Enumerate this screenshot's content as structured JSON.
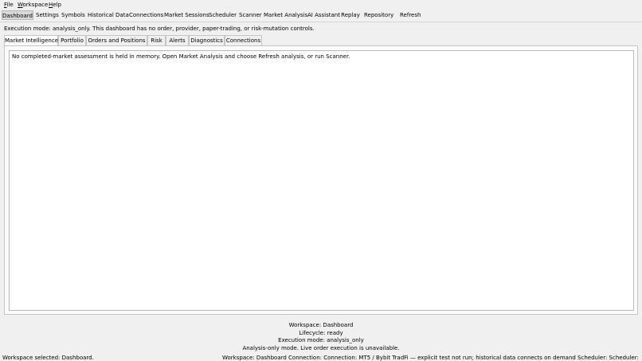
{
  "menubar": {
    "items": [
      {
        "mnemonic": "F",
        "rest": "ile"
      },
      {
        "mnemonic": "W",
        "rest": "orkspace"
      },
      {
        "mnemonic": "H",
        "rest": "elp"
      }
    ]
  },
  "toolbar": {
    "items": [
      "Dashboard",
      "Settings",
      "Symbols",
      "Historical Data",
      "Connections",
      "Market Sessions",
      "Scheduler",
      "Scanner",
      "Market Analysis",
      "AI Assistant",
      "Replay",
      "Repository",
      "Refresh"
    ],
    "active": "Dashboard"
  },
  "execution_note": "Execution mode: analysis_only. This dashboard has no order, provider, paper-trading, or risk-mutation controls.",
  "tabs": {
    "items": [
      "Market Intelligence",
      "Portfolio",
      "Orders and Positions",
      "Risk",
      "Alerts",
      "Diagnostics",
      "Connections"
    ],
    "active": "Market Intelligence"
  },
  "panel": {
    "message": "No completed-market assessment is held in memory. Open Market Analysis and choose Refresh analysis, or run Scanner."
  },
  "info": {
    "workspace": "Workspace: Dashboard",
    "lifecycle": "Lifecycle: ready",
    "execution_mode": "Execution mode: analysis_only",
    "analysis_note": "Analysis-only mode. Live order execution is unavailable."
  },
  "statusbar": {
    "left": "Workspace selected: Dashboard.",
    "right": "Workspace: Dashboard  Connection: Connection: MT5 / Bybit TradFi — explicit test not run; historical data connects on demand  Scheduler: Scheduler: Stopped  Mode: analysis_only"
  }
}
